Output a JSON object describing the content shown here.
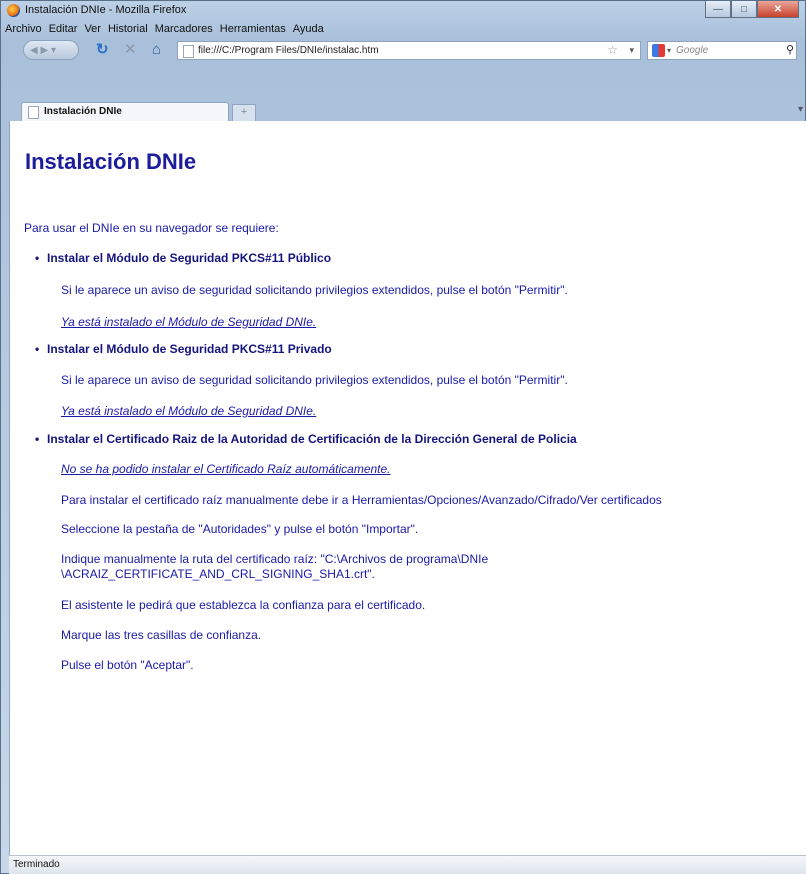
{
  "window": {
    "title": "Instalación DNIe - Mozilla Firefox"
  },
  "menu": [
    "Archivo",
    "Editar",
    "Ver",
    "Historial",
    "Marcadores",
    "Herramientas",
    "Ayuda"
  ],
  "nav": {
    "url": "file:///C:/Program Files/DNIe/instalac.htm",
    "search_placeholder": "Google"
  },
  "tab": {
    "label": "Instalación DNIe",
    "new_tab": "+"
  },
  "page": {
    "heading": "Instalación DNIe",
    "intro": "Para usar el DNIe en su navegador se requiere:",
    "item1": {
      "title": "Instalar el Módulo de Seguridad PKCS#11 Público",
      "text": "Si le aparece un aviso de seguridad solicitando privilegios extendidos, pulse el botón \"Permitir\".",
      "link": "Ya está instalado el Módulo de Seguridad DNIe."
    },
    "item2": {
      "title": "Instalar el Módulo de Seguridad PKCS#11 Privado",
      "text": "Si le aparece un aviso de seguridad solicitando privilegios extendidos, pulse el botón \"Permitir\".",
      "link": "Ya está instalado el Módulo de Seguridad DNIe."
    },
    "item3": {
      "title": "Instalar el Certificado Raiz de la Autoridad de Certificación de la Dirección General de Policia",
      "link": "No se ha podido instalar el Certificado Raíz automáticamente.",
      "steps": [
        "Para instalar el certificado raíz manualmente debe ir a Herramientas/Opciones/Avanzado/Cifrado/Ver certificados",
        "Seleccione la pestaña de \"Autoridades\" y pulse el botón \"Importar\".",
        "Indique manualmente la ruta del certificado raíz: \"C:\\Archivos de programa\\DNIe",
        "\\ACRAIZ_CERTIFICATE_AND_CRL_SIGNING_SHA1.crt\".",
        "El asistente le pedirá que establezca la confianza para el certificado.",
        "Marque las tres casillas de confianza.",
        "Pulse el botón \"Aceptar\"."
      ]
    }
  },
  "status": "Terminado"
}
